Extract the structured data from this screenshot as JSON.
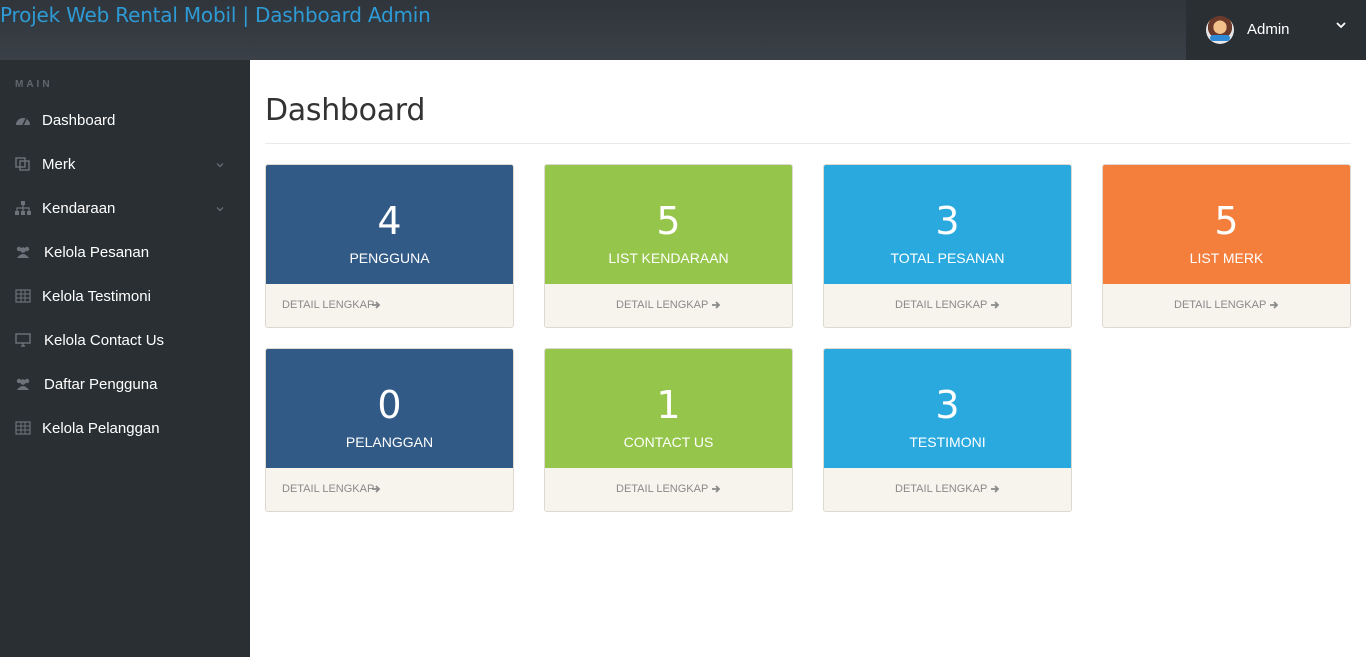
{
  "header": {
    "brand": "Projek Web Rental Mobil | Dashboard Admin",
    "user": {
      "name": "Admin",
      "avatar_icon": "avatar",
      "caret_icon": "chevron-down-icon"
    }
  },
  "sidebar": {
    "heading": "MAIN",
    "items": [
      {
        "label": "Dashboard",
        "icon": "dashboard-icon",
        "has_chevron": false
      },
      {
        "label": "Merk",
        "icon": "copy-icon",
        "has_chevron": true
      },
      {
        "label": "Kendaraan",
        "icon": "sitemap-icon",
        "has_chevron": true
      },
      {
        "label": "Kelola Pesanan",
        "icon": "users-icon",
        "has_chevron": false
      },
      {
        "label": "Kelola Testimoni",
        "icon": "table-icon",
        "has_chevron": false
      },
      {
        "label": "Kelola Contact Us",
        "icon": "desktop-icon",
        "has_chevron": false
      },
      {
        "label": "Daftar Pengguna",
        "icon": "users-icon",
        "has_chevron": false
      },
      {
        "label": "Kelola Pelanggan",
        "icon": "table-icon",
        "has_chevron": false
      }
    ]
  },
  "main": {
    "title": "Dashboard",
    "cards": [
      {
        "value": "4",
        "label": "PENGGUNA",
        "link": "DETAIL LENGKAP",
        "color": "#315a87"
      },
      {
        "value": "5",
        "label": "LIST KENDARAAN",
        "link": "DETAIL LENGKAP",
        "color": "#95c54a"
      },
      {
        "value": "3",
        "label": "TOTAL PESANAN",
        "link": "DETAIL LENGKAP",
        "color": "#2aa9df"
      },
      {
        "value": "5",
        "label": "LIST MERK",
        "link": "DETAIL LENGKAP",
        "color": "#f47e3c"
      },
      {
        "value": "0",
        "label": "PELANGGAN",
        "link": "DETAIL LENGKAP",
        "color": "#315a87"
      },
      {
        "value": "1",
        "label": "CONTACT US",
        "link": "DETAIL LENGKAP",
        "color": "#95c54a"
      },
      {
        "value": "3",
        "label": "TESTIMONI",
        "link": "DETAIL LENGKAP",
        "color": "#2aa9df"
      }
    ]
  }
}
